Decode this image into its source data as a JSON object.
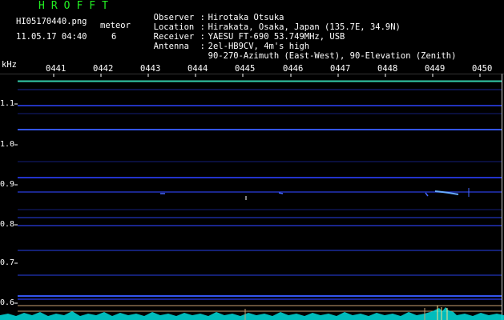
{
  "header": {
    "app_title": "HROFFT",
    "filename": "HI05170440.png",
    "datetime": "11.05.17 04:40",
    "meteor_label": "meteor",
    "meteor_count": "6"
  },
  "station_info": [
    {
      "key": "Observer",
      "value": "Hirotaka Otsuka"
    },
    {
      "key": "Location",
      "value": "Hirakata, Osaka, Japan (135.7E, 34.9N)"
    },
    {
      "key": "Receiver",
      "value": "YAESU FT-690 53.749MHz, USB"
    },
    {
      "key": "Antenna",
      "value": "2el-HB9CV, 4m's high"
    },
    {
      "key": "",
      "value": "90-270-Azimuth (East-West), 90-Elevation (Zenith)"
    }
  ],
  "separator": ":",
  "axis": {
    "y_unit": "kHz",
    "y_ticks": [
      "1.1",
      "1.0",
      "0.9",
      "0.8",
      "0.7",
      "0.6"
    ],
    "x_ticks": [
      "0441",
      "0442",
      "0443",
      "0444",
      "0445",
      "0446",
      "0447",
      "0448",
      "0449",
      "0450"
    ]
  },
  "colors": {
    "background": "#000000",
    "title": "#22ee22",
    "text": "#ffffff",
    "signal": "#2233cc",
    "signal_bright": "#00ccff",
    "noise_floor": "#00dddd",
    "marker_line": "#c8a070"
  }
}
